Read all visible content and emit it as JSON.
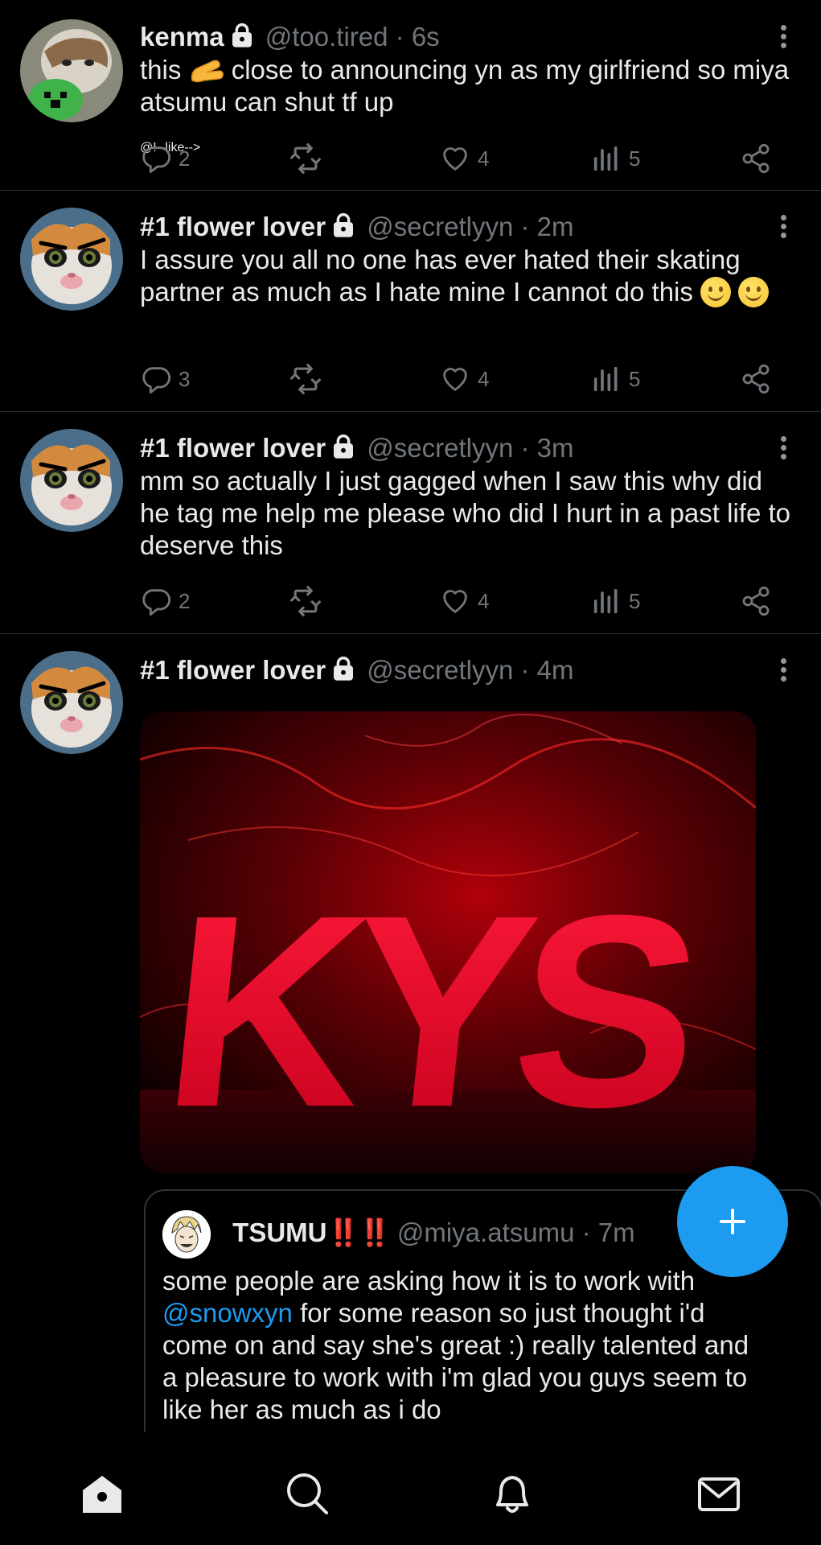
{
  "tweets": [
    {
      "name": "kenma",
      "handle": "@too.tired",
      "time": "· 6s",
      "text_a": "this",
      "text_b": "close to announcing yn as my girlfriend so miya atsumu can shut tf up",
      "replies": "2",
      "likes": "4",
      "views": "5"
    },
    {
      "name": "#1 flower lover",
      "handle": "@secretlyyn",
      "time": "· 2m",
      "text": "I assure you all no one has ever hated their skating partner as much as I hate mine I cannot do this",
      "replies": "3",
      "likes": "4",
      "views": "5"
    },
    {
      "name": "#1 flower lover",
      "handle": "@secretlyyn",
      "time": "· 3m",
      "text": "mm so actually I just gagged when I saw this why did he tag me help me please who did I hurt in a past life to deserve this",
      "replies": "2",
      "likes": "4",
      "views": "5"
    },
    {
      "name": "#1 flower lover",
      "handle": "@secretlyyn",
      "time": "· 4m",
      "image_text": "KYS",
      "quote": {
        "name": "TSUMU",
        "bangs": "‼️‼️",
        "handle": "@miya.atsumu",
        "time": "· 7m",
        "text_a": "some people are asking how it is to work with",
        "mention": "@snowxyn",
        "text_b": "for some reason so just thought i'd come on and say she's great :) really talented and a pleasure to work with i'm glad you guys seem to like her as much as i do"
      }
    }
  ],
  "icons": {
    "reply": "reply-icon",
    "retweet": "retweet-icon",
    "like": "heart-icon",
    "views": "views-icon",
    "share": "share-icon",
    "more": "more-icon",
    "compose": "plus-icon",
    "nav": [
      "home-icon",
      "search-icon",
      "bell-icon",
      "mail-icon"
    ]
  },
  "colors": {
    "background": "#000000",
    "accent": "#1d9bf0",
    "muted": "#71767b",
    "divider": "#2f3336"
  }
}
